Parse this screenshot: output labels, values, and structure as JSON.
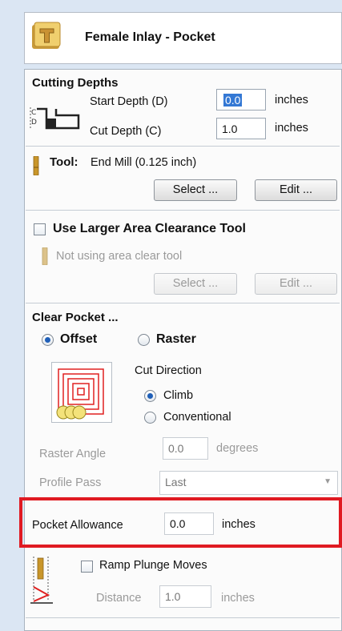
{
  "header": {
    "title": "Female Inlay - Pocket",
    "icon": "toolpath-icon"
  },
  "cutting_depths": {
    "title": "Cutting Depths",
    "start_label": "Start Depth (D)",
    "start_value": "0.0",
    "start_units": "inches",
    "cut_label": "Cut Depth (C)",
    "cut_value": "1.0",
    "cut_units": "inches"
  },
  "tool": {
    "label": "Tool:",
    "name": "End Mill (0.125 inch)",
    "select_label": "Select ...",
    "edit_label": "Edit ..."
  },
  "area_clearance": {
    "title": "Use Larger Area Clearance Tool",
    "checked": false,
    "status": "Not using area clear tool",
    "select_label": "Select ...",
    "edit_label": "Edit ..."
  },
  "clear_pocket": {
    "title": "Clear Pocket ...",
    "offset_label": "Offset",
    "raster_label": "Raster",
    "selected": "Offset",
    "cut_direction_label": "Cut Direction",
    "climb_label": "Climb",
    "conventional_label": "Conventional",
    "direction": "Climb",
    "raster_angle_label": "Raster Angle",
    "raster_angle_value": "0.0",
    "raster_angle_units": "degrees",
    "profile_pass_label": "Profile Pass",
    "profile_pass_value": "Last"
  },
  "pocket_allowance": {
    "label": "Pocket Allowance",
    "value": "0.0",
    "units": "inches"
  },
  "ramp": {
    "label": "Ramp Plunge Moves",
    "checked": false,
    "distance_label": "Distance",
    "distance_value": "1.0",
    "distance_units": "inches"
  },
  "colors": {
    "highlight": "#e01a22",
    "panel_bg": "#dbe6f3",
    "radio_dot": "#1f5fb8"
  }
}
